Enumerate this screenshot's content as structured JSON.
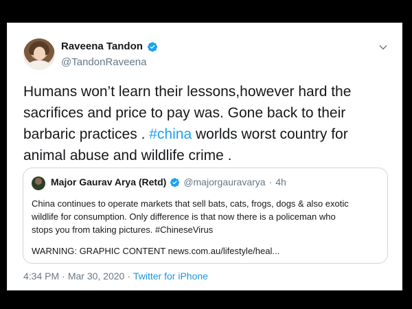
{
  "tweet": {
    "display_name": "Raveena Tandon",
    "handle": "@TandonRaveena",
    "text_before_hashtag": "Humans won’t learn their lessons,however hard the sacrifices and price to pay was. Gone back to their barbaric practices . ",
    "hashtag": "#china",
    "text_after_hashtag": " worlds worst country for animal abuse and wildlife crime .",
    "time": "4:34 PM",
    "separator": "·",
    "date": "Mar 30, 2020",
    "source": "Twitter for iPhone"
  },
  "quoted_tweet": {
    "display_name": "Major Gaurav Arya (Retd)",
    "handle": "@majorgauravarya",
    "separator": "·",
    "age": "4h",
    "body_lines": [
      "China continues to operate markets that sell bats, cats, frogs, dogs & also exotic",
      "wildlife for consumption. Only difference is that now there is a policeman who",
      "stops you from taking pictures. #ChineseVirus"
    ],
    "warning_line": "WARNING: GRAPHIC CONTENT news.com.au/lifestyle/heal..."
  },
  "icons": {
    "verified": "verified-badge-icon",
    "menu": "chevron-down-icon"
  },
  "colors": {
    "background": "#000000",
    "card": "#ffffff",
    "link": "#1da1f2",
    "secondary_text": "#657786"
  }
}
